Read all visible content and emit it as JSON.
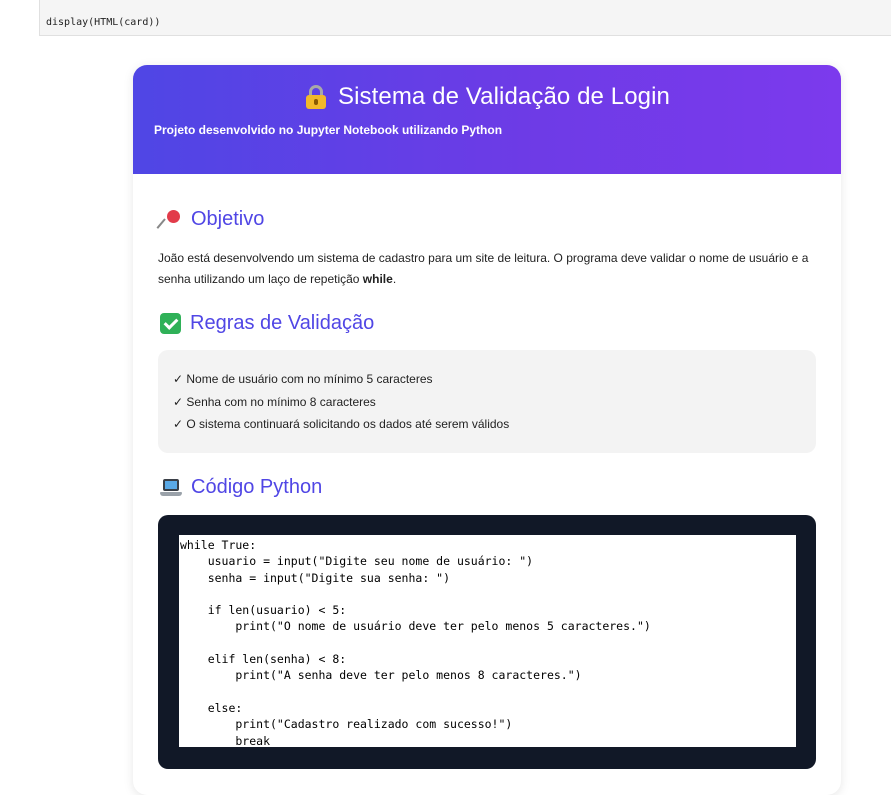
{
  "input_cell": {
    "code": "display(HTML(card))"
  },
  "card": {
    "title": "Sistema de Validação de Login",
    "subtitle": "Projeto desenvolvido no Jupyter Notebook utilizando Python",
    "header_gradient": [
      "#4f46e5",
      "#7c3aed"
    ],
    "accent_color": "#5046e5",
    "objetivo": {
      "heading": "Objetivo",
      "icon": "pushpin-icon",
      "text_before": "João está desenvolvendo um sistema de cadastro para um site de leitura. O programa deve validar o nome de usuário e a senha utilizando um laço de repetição ",
      "text_bold": "while",
      "text_after": "."
    },
    "regras": {
      "heading": "Regras de Validação",
      "icon": "check-box-icon",
      "items": [
        "✓ Nome de usuário com no mínimo 5 caracteres",
        "✓ Senha com no mínimo 8 caracteres",
        "✓ O sistema continuará solicitando os dados até serem válidos"
      ]
    },
    "codigo": {
      "heading": "Código Python",
      "icon": "laptop-icon",
      "code": "while True:\n    usuario = input(\"Digite seu nome de usuário: \")\n    senha = input(\"Digite sua senha: \")\n\n    if len(usuario) < 5:\n        print(\"O nome de usuário deve ter pelo menos 5 caracteres.\")\n\n    elif len(senha) < 8:\n        print(\"A senha deve ter pelo menos 8 caracteres.\")\n\n    else:\n        print(\"Cadastro realizado com sucesso!\")\n        break"
    }
  }
}
